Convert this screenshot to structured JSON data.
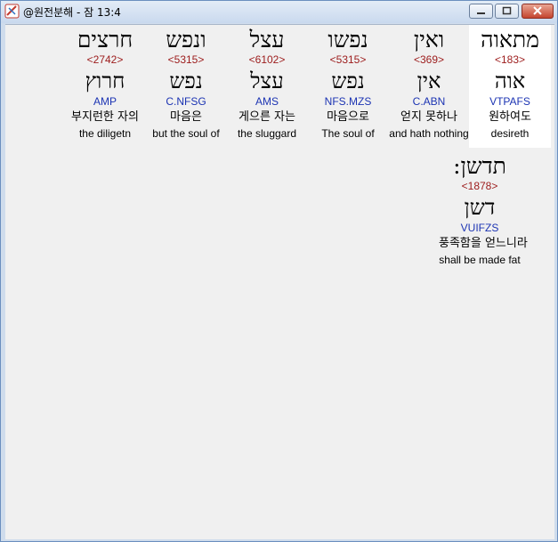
{
  "window": {
    "title": "@원전분해 - 잠 13:4",
    "accent": "#6b8fbf"
  },
  "row1": [
    {
      "hebrew": "מתאוה",
      "strong": "<183>",
      "lemma": "אוה",
      "morph": "VTPAFS",
      "korean": "원하여도",
      "english": "desireth",
      "selected": true
    },
    {
      "hebrew": "ואין",
      "strong": "<369>",
      "lemma": "אין",
      "morph": "C.ABN",
      "korean": "얻지 못하나",
      "english": "and hath nothing",
      "selected": false
    },
    {
      "hebrew": "נפשו",
      "strong": "<5315>",
      "lemma": "נפש",
      "morph": "NFS.MZS",
      "korean": "마음으로",
      "english": "The soul of",
      "selected": false
    },
    {
      "hebrew": "עצל",
      "strong": "<6102>",
      "lemma": "עצל",
      "morph": "AMS",
      "korean": "게으른 자는",
      "english": "the sluggard",
      "selected": false
    },
    {
      "hebrew": "ונפש",
      "strong": "<5315>",
      "lemma": "נפש",
      "morph": "C.NFSG",
      "korean": "마음은",
      "english": "but the soul of",
      "selected": false
    },
    {
      "hebrew": "חרצים",
      "strong": "<2742>",
      "lemma": "חרוץ",
      "morph": "AMP",
      "korean": "부지런한 자의",
      "english": "the diligetn",
      "selected": false
    }
  ],
  "row2": [
    {
      "hebrew": "תדשן:",
      "strong": "<1878>",
      "lemma": "דשן",
      "morph": "VUIFZS",
      "korean": "풍족함을 얻느니라",
      "english": "shall be made fat",
      "selected": false
    }
  ]
}
